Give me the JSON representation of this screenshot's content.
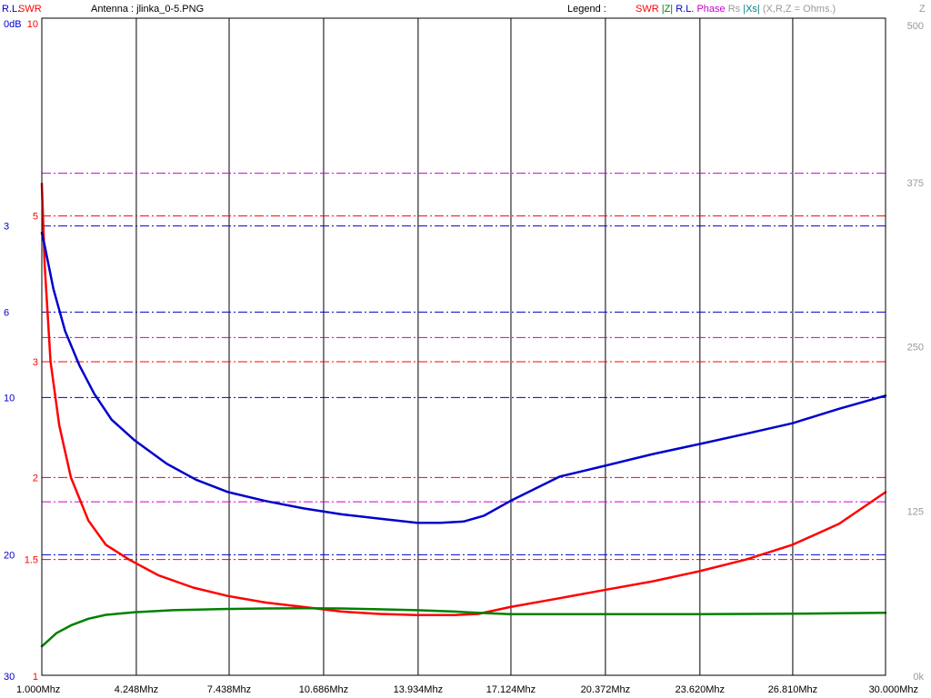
{
  "header": {
    "rl_label": "R.L.",
    "swr_label": "SWR",
    "antenna_text": "Antenna : jlinka_0-5.PNG",
    "legend_label": "Legend :",
    "z_label": "Z"
  },
  "legend": [
    {
      "text": "SWR",
      "color": "#ff0000"
    },
    {
      "text": "|Z|",
      "color": "#008000"
    },
    {
      "text": "R.L.",
      "color": "#0000cc"
    },
    {
      "text": "Phase",
      "color": "#cc00cc"
    },
    {
      "text": "Rs",
      "color": "#999999"
    },
    {
      "text": "|Xs|",
      "color": "#008080"
    },
    {
      "text": "(X,R,Z = Ohms.)",
      "color": "#999999"
    }
  ],
  "colors": {
    "swr": "#ff0000",
    "z": "#008000",
    "rl": "#0000cc",
    "phase": "#cc00cc",
    "grid": "#000000"
  },
  "chart_data": {
    "type": "line",
    "x_range": [
      1.0,
      30.0
    ],
    "x_unit": "Mhz",
    "x_ticks": [
      {
        "v": 1.0,
        "label": "1.000Mhz"
      },
      {
        "v": 4.248,
        "label": "4.248Mhz"
      },
      {
        "v": 7.438,
        "label": "7.438Mhz"
      },
      {
        "v": 10.686,
        "label": "10.686Mhz"
      },
      {
        "v": 13.934,
        "label": "13.934Mhz"
      },
      {
        "v": 17.124,
        "label": "17.124Mhz"
      },
      {
        "v": 20.372,
        "label": "20.372Mhz"
      },
      {
        "v": 23.62,
        "label": "23.620Mhz"
      },
      {
        "v": 26.81,
        "label": "26.810Mhz"
      },
      {
        "v": 30.0,
        "label": "30.000Mhz"
      }
    ],
    "swr_axis": {
      "scale": "log",
      "range": [
        1,
        10
      ],
      "ticks": [
        {
          "v": 10,
          "label": "10"
        },
        {
          "v": 5,
          "label": "5"
        },
        {
          "v": 3,
          "label": "3"
        },
        {
          "v": 2,
          "label": "2"
        },
        {
          "v": 1.5,
          "label": "1.5"
        },
        {
          "v": 1,
          "label": "1"
        }
      ]
    },
    "rl_axis": {
      "scale": "linear",
      "range": [
        0,
        30
      ],
      "unit": "dB",
      "ticks": [
        {
          "v": 0,
          "label": "0dB"
        },
        {
          "v": 3,
          "label": "3"
        },
        {
          "v": 6,
          "label": "6"
        },
        {
          "v": 10,
          "label": "10"
        },
        {
          "v": 20,
          "label": "20"
        },
        {
          "v": 30,
          "label": "30"
        }
      ]
    },
    "z_axis": {
      "scale": "linear",
      "range": [
        0,
        500
      ],
      "unit": "Ohms",
      "ticks": [
        {
          "v": 500,
          "label": "500"
        },
        {
          "v": 375,
          "label": "375"
        },
        {
          "v": 250,
          "label": "250"
        },
        {
          "v": 125,
          "label": "125"
        },
        {
          "v": 0,
          "label": "0k"
        }
      ]
    },
    "phase_gridlines": [
      375,
      250,
      125
    ],
    "series": [
      {
        "name": "SWR",
        "axis": "swr",
        "x": [
          1.0,
          1.1,
          1.3,
          1.6,
          2.0,
          2.6,
          3.2,
          4.0,
          5.0,
          6.2,
          7.4,
          8.7,
          10.0,
          11.3,
          12.6,
          13.9,
          15.2,
          16.0,
          17.1,
          18.8,
          20.4,
          22.0,
          23.6,
          25.2,
          26.8,
          28.4,
          30.0
        ],
        "y": [
          5.6,
          4.2,
          3.0,
          2.4,
          2.0,
          1.72,
          1.58,
          1.5,
          1.42,
          1.36,
          1.32,
          1.29,
          1.27,
          1.25,
          1.24,
          1.235,
          1.235,
          1.24,
          1.27,
          1.31,
          1.35,
          1.39,
          1.44,
          1.5,
          1.58,
          1.7,
          1.9
        ]
      },
      {
        "name": "|Z|",
        "axis": "z",
        "x": [
          1.0,
          1.2,
          1.5,
          2.0,
          2.6,
          3.2,
          4.2,
          5.5,
          7.4,
          8.7,
          10.0,
          11.3,
          12.6,
          13.9,
          15.2,
          16.0,
          17.1,
          18.8,
          20.4,
          23.6,
          26.8,
          28.4,
          30.0
        ],
        "y": [
          22,
          26,
          32,
          38,
          43,
          46,
          48,
          49.5,
          50.5,
          50.8,
          51,
          50.8,
          50.2,
          49.5,
          48.5,
          47.5,
          46.5,
          46.5,
          46.5,
          46.5,
          46.8,
          47.2,
          47.5
        ]
      },
      {
        "name": "R.L.",
        "axis": "rl",
        "x": [
          1.0,
          1.1,
          1.4,
          1.8,
          2.3,
          2.8,
          3.4,
          4.2,
          5.3,
          6.3,
          7.4,
          8.7,
          10.0,
          11.3,
          12.6,
          13.9,
          14.7,
          15.5,
          16.2,
          17.1,
          18.8,
          20.4,
          22.0,
          23.6,
          25.2,
          26.8,
          28.4,
          30.0
        ],
        "y": [
          3.2,
          3.6,
          5.1,
          6.8,
          8.4,
          9.8,
          11.2,
          12.4,
          13.8,
          14.8,
          15.6,
          16.2,
          16.7,
          17.1,
          17.4,
          17.7,
          17.7,
          17.6,
          17.2,
          16.2,
          14.6,
          13.9,
          13.2,
          12.6,
          12.0,
          11.4,
          10.6,
          9.9
        ]
      }
    ]
  }
}
